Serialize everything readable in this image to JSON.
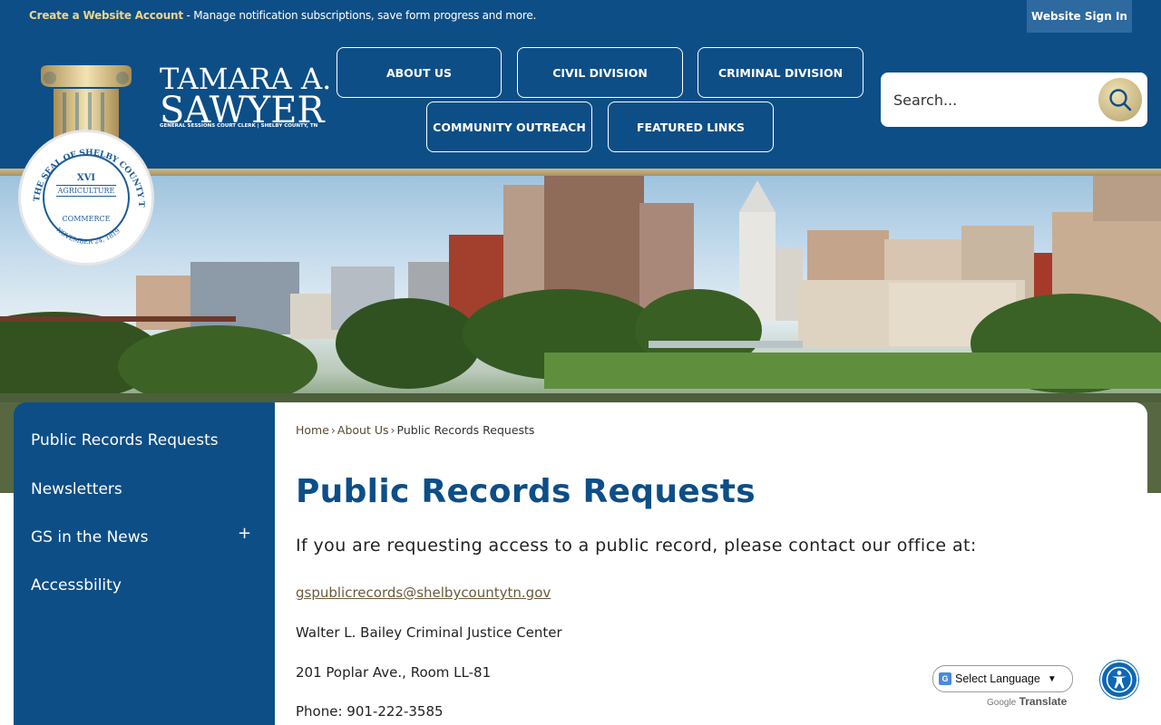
{
  "topbar": {
    "create_account_label": "Create a Website Account",
    "message": " - Manage notification subscriptions, save form progress and more.",
    "sign_in_label": "Website Sign In"
  },
  "branding": {
    "name_line1": "TAMARA A.",
    "name_line2": "SAWYER",
    "subtitle": "GENERAL SESSIONS COURT CLERK | SHELBY COUNTY, TN",
    "seal_text_top": "THE SEAL OF SHELBY COUNTY TENNESSEE",
    "seal_numeral": "XVI",
    "seal_word1": "AGRICULTURE",
    "seal_word2": "COMMERCE",
    "seal_date": "NOVEMBER 24, 1819"
  },
  "nav": {
    "items": [
      {
        "label": "ABOUT US"
      },
      {
        "label": "CIVIL DIVISION"
      },
      {
        "label": "CRIMINAL DIVISION"
      },
      {
        "label": "COMMUNITY OUTREACH"
      },
      {
        "label": "FEATURED LINKS"
      }
    ]
  },
  "search": {
    "placeholder": "Search...",
    "icon": "search-icon"
  },
  "sidebar": {
    "items": [
      {
        "label": "Public Records Requests"
      },
      {
        "label": "Newsletters"
      },
      {
        "label": "GS in the News"
      },
      {
        "label": "Accessbility"
      }
    ],
    "expand_symbol": "+"
  },
  "breadcrumb": {
    "items": [
      "Home",
      "About Us",
      "Public Records Requests"
    ],
    "separator": "›"
  },
  "content": {
    "title": "Public Records Requests",
    "intro": "If you are requesting access to a public record, please contact our office at:",
    "email": "gspublicrecords@shelbycountytn.gov",
    "address_line1": "Walter L. Bailey Criminal Justice Center",
    "address_line2": "201 Poplar Ave., Room LL-81",
    "phone": "Phone: 901-222-3585"
  },
  "translate": {
    "select_label": "Select Language",
    "powered_google": "Google",
    "powered_translate": "Translate"
  },
  "colors": {
    "primary_blue": "#0d4e87",
    "gold": "#c9b98e",
    "link_brown": "#6b5a3a"
  }
}
